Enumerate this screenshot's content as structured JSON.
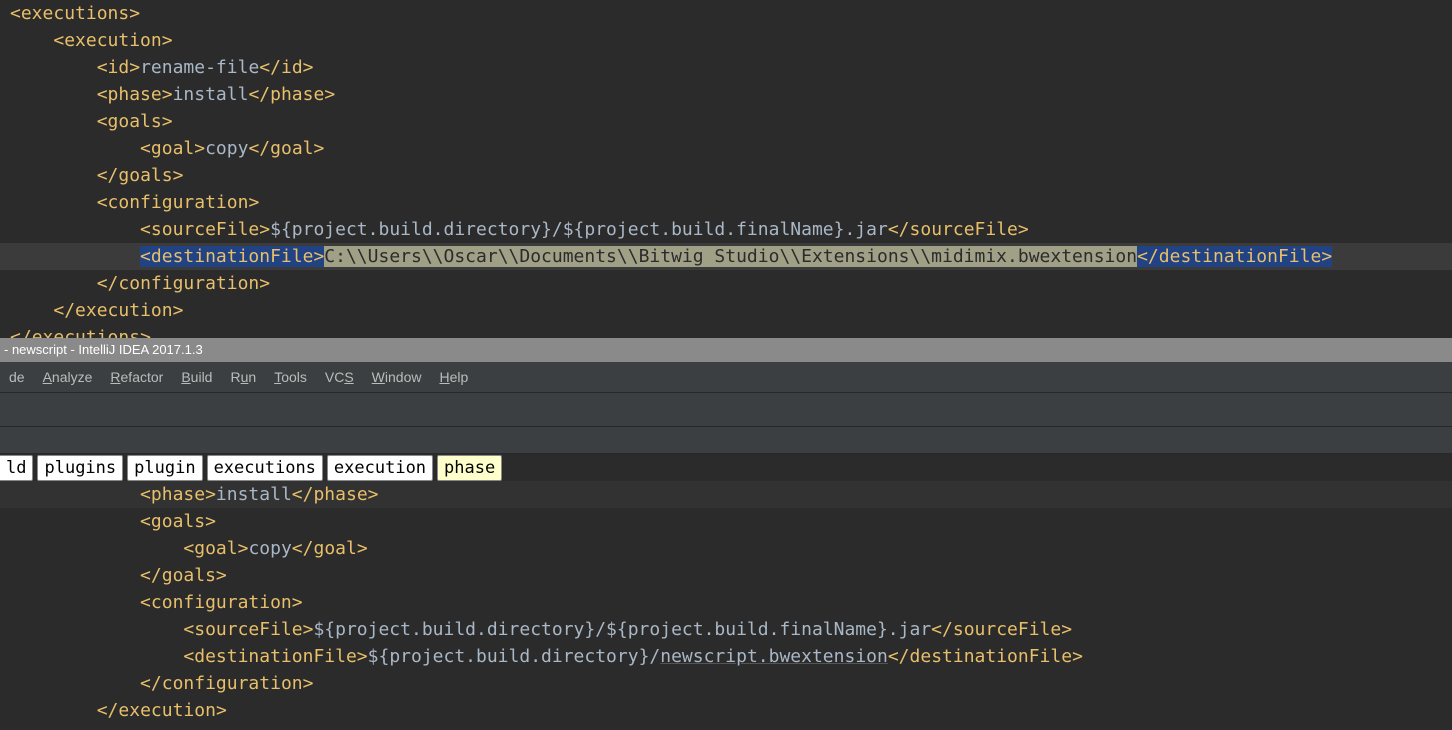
{
  "titlebar": "- newscript - IntelliJ IDEA 2017.1.3",
  "menu": {
    "code": "de",
    "analyze": "Analyze",
    "refactor": "Refactor",
    "build": "Build",
    "run": "Run",
    "tools": "Tools",
    "vcs": "VCS",
    "window": "Window",
    "help": "Help"
  },
  "breadcrumbs": [
    "ld",
    "plugins",
    "plugin",
    "executions",
    "execution",
    "phase"
  ],
  "code_top": {
    "l1": {
      "t": "executions"
    },
    "l2": {
      "t": "execution"
    },
    "l3": {
      "t": "id",
      "v": "rename-file"
    },
    "l4": {
      "t": "phase",
      "v": "install"
    },
    "l5": {
      "t": "goals"
    },
    "l6": {
      "t": "goal",
      "v": "copy"
    },
    "l7": {
      "t": "goals"
    },
    "l8": {
      "t": "configuration"
    },
    "l9": {
      "t": "sourceFile",
      "v": "${project.build.directory}/${project.build.finalName}.jar"
    },
    "l10": {
      "t": "destinationFile",
      "v": "C:\\\\Users\\\\Oscar\\\\Documents\\\\Bitwig Studio\\\\Extensions\\\\midimix.bwextension"
    },
    "l11": {
      "t": "configuration"
    },
    "l12": {
      "t": "execution"
    },
    "l13": {
      "t": "executions"
    }
  },
  "code_bottom": {
    "l1": {
      "t": "phase",
      "v": "install"
    },
    "l2": {
      "t": "goals"
    },
    "l3": {
      "t": "goal",
      "v": "copy"
    },
    "l4": {
      "t": "goals"
    },
    "l5": {
      "t": "configuration"
    },
    "l6": {
      "t": "sourceFile",
      "v": "${project.build.directory}/${project.build.finalName}.jar"
    },
    "l7": {
      "t": "destinationFile",
      "v1": "${project.build.directory}/",
      "v2": "newscript.bwextension"
    },
    "l8": {
      "t": "configuration"
    },
    "l9": {
      "t": "execution"
    }
  }
}
